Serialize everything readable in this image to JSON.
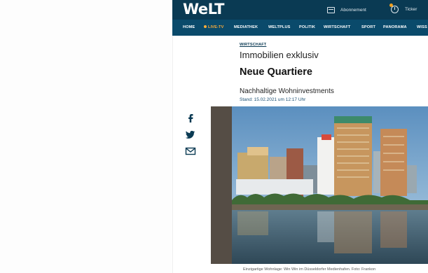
{
  "header": {
    "logo": "WeLT",
    "abonnement_label": "Abonnement",
    "ticker_label": "Ticker",
    "brand_color": "#0a3a53"
  },
  "nav": {
    "items": [
      {
        "label": "HOME"
      },
      {
        "label": "LIVE-TV"
      },
      {
        "label": "MEDIATHEK"
      },
      {
        "label": "WELTPLUS"
      },
      {
        "label": "POLITIK"
      },
      {
        "label": "WIRTSCHAFT"
      },
      {
        "label": "SPORT"
      },
      {
        "label": "PANORAMA"
      },
      {
        "label": "WISS"
      }
    ],
    "live_color": "#ffae3a"
  },
  "article": {
    "kicker": "WIRTSCHAFT",
    "rubric": "Immobilien exklusiv",
    "headline": "Neue Quartiere",
    "subline": "Nachhaltige Wohninvestments",
    "timestamp": "Stand: 15.02.2021 um 12:17 Uhr",
    "caption": "Einzigartige Wohnlage: Win Win im Düsseldorfer Medienhafen. Foto: Frankon"
  },
  "share": {
    "icons": [
      "facebook-icon",
      "twitter-icon",
      "mail-icon"
    ]
  }
}
